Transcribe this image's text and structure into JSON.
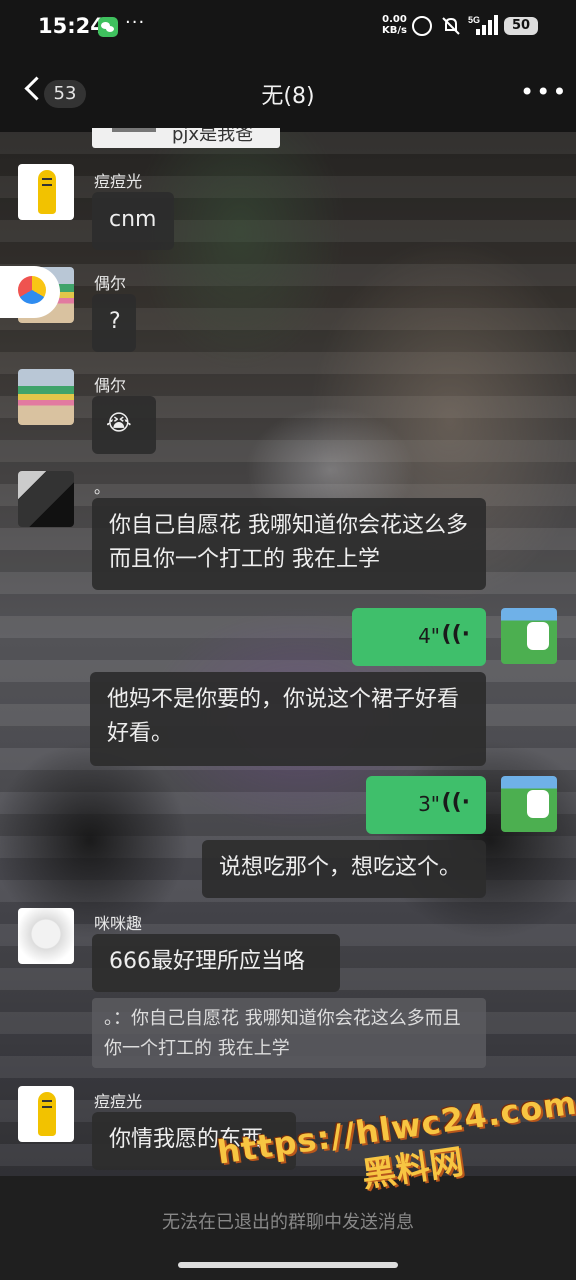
{
  "status_bar": {
    "time": "15:24",
    "more": "···",
    "net_speed_value": "0.00",
    "net_speed_unit": "KB/s",
    "network": "5G",
    "battery": "50"
  },
  "header": {
    "back_count": "53",
    "title": "无(8)"
  },
  "quote_top": {
    "text": "pjx是我爸"
  },
  "messages": [
    {
      "sender": "痘痘光",
      "text": "cnm"
    },
    {
      "sender": "偶尔",
      "text": "?"
    },
    {
      "sender": "偶尔",
      "text": "😭"
    },
    {
      "sender": "。",
      "text": "你自己自愿花 我哪知道你会花这么多而且你一个打工的 我在上学"
    },
    {
      "voice_duration": "4\""
    },
    {
      "text": "他妈不是你要的，你说这个裙子好看好看。"
    },
    {
      "voice_duration": "3\""
    },
    {
      "text": "说想吃那个，想吃这个。"
    },
    {
      "sender": "咪咪趣",
      "text": "666最好理所应当咯"
    },
    {
      "quote": "。：你自己自愿花 我哪知道你会花这么多而且你一个打工的 我在上学"
    },
    {
      "sender": "痘痘光",
      "text": "你情我愿的东西"
    }
  ],
  "bottom": {
    "notice": "无法在已退出的群聊中发送消息"
  },
  "watermark": {
    "url": "https://hlwc24.com",
    "name": "黑料网"
  },
  "icons": {
    "voice": "((·"
  },
  "colors": {
    "my_bubble": "#3fbf6b",
    "other_bubble": "#2c2c2c",
    "wechat": "#3fc15e"
  }
}
